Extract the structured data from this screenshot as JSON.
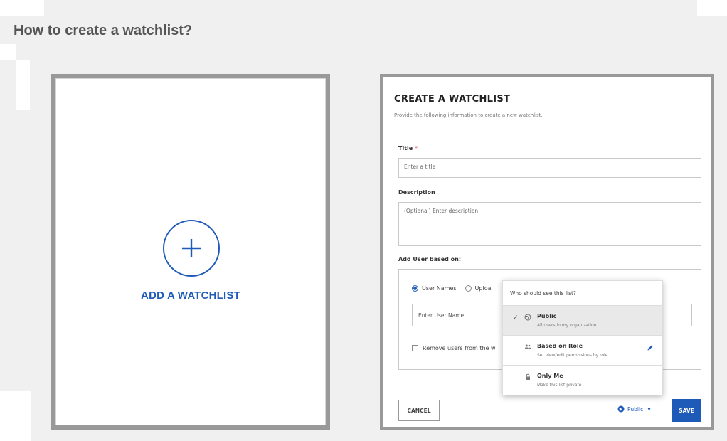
{
  "page": {
    "heading": "How to create a watchlist?"
  },
  "left_card": {
    "add_label": "ADD A WATCHLIST"
  },
  "dialog": {
    "title": "CREATE A WATCHLIST",
    "subtitle": "Provide the following information to create a new watchlist.",
    "title_label": "Title",
    "required_mark": "*",
    "title_placeholder": "Enter a title",
    "description_label": "Description",
    "description_placeholder": "(Optional) Enter description",
    "add_user_label": "Add User based on:",
    "radio_user_names": "User Names",
    "radio_upload": "Uploa",
    "user_name_placeholder": "Enter User Name",
    "remove_users_label": "Remove users from the w",
    "cancel_label": "CANCEL",
    "visibility_label": "Public",
    "save_label": "SAVE"
  },
  "visibility_menu": {
    "header": "Who should see this list?",
    "items": [
      {
        "title": "Public",
        "desc": "All users in my organization",
        "selected": true,
        "icon": "globe-icon"
      },
      {
        "title": "Based on Role",
        "desc": "Set view/edit permissions by role",
        "selected": false,
        "icon": "users-icon"
      },
      {
        "title": "Only Me",
        "desc": "Make this list private",
        "selected": false,
        "icon": "lock-icon"
      }
    ]
  },
  "colors": {
    "accent": "#1e5bb8",
    "frame": "#999999",
    "background": "#f0f0f0"
  }
}
